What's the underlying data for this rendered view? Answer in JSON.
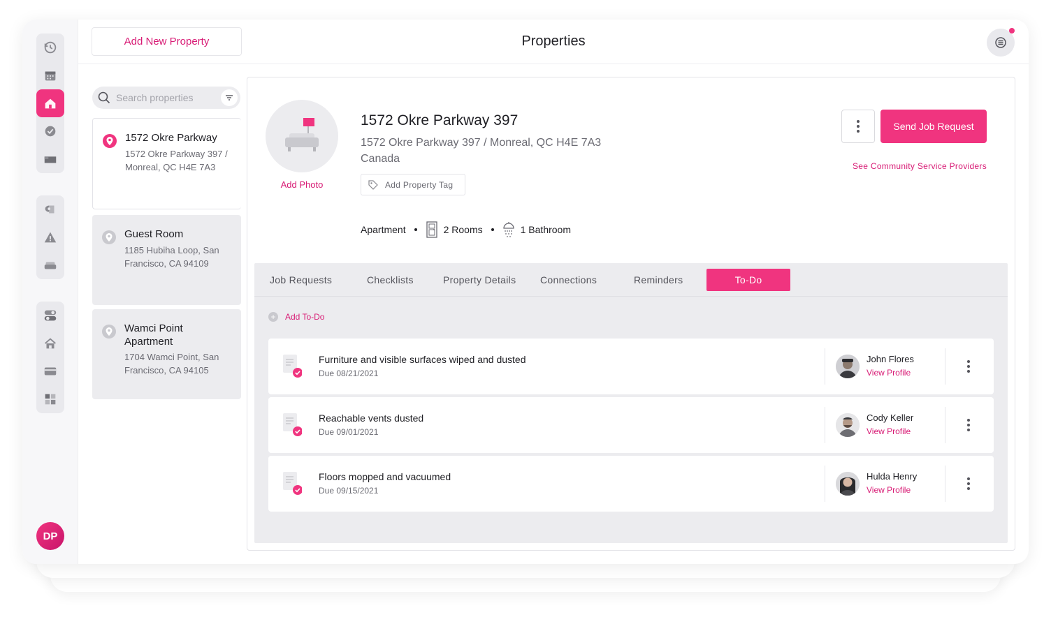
{
  "header": {
    "add_property_label": "Add New Property",
    "title": "Properties"
  },
  "search": {
    "placeholder": "Search properties"
  },
  "properties": [
    {
      "name": "1572 Okre Parkway",
      "address": "1572 Okre Parkway 397 / Monreal, QC H4E 7A3",
      "selected": true
    },
    {
      "name": "Guest Room",
      "address": "1185 Hubiha Loop, San Francisco, CA 94109",
      "selected": false
    },
    {
      "name": "Wamci Point Apartment",
      "address": "1704 Wamci Point, San Francisco, CA 94105",
      "selected": false
    }
  ],
  "detail": {
    "title": "1572 Okre Parkway 397",
    "address_line1": "1572 Okre Parkway 397 / Monreal, QC H4E 7A3",
    "address_line2": "Canada",
    "add_photo_label": "Add Photo",
    "add_tag_label": "Add Property Tag",
    "type": "Apartment",
    "rooms": "2 Rooms",
    "bathrooms": "1 Bathroom",
    "send_job_label": "Send Job Request",
    "community_link": "See Community Service Providers"
  },
  "tabs": [
    {
      "label": "Job Requests",
      "active": false
    },
    {
      "label": "Checklists",
      "active": false
    },
    {
      "label": "Property Details",
      "active": false
    },
    {
      "label": "Connections",
      "active": false
    },
    {
      "label": "Reminders",
      "active": false
    },
    {
      "label": "To-Do",
      "active": true
    }
  ],
  "todo": {
    "add_label": "Add To-Do",
    "view_profile_label": "View Profile",
    "items": [
      {
        "title": "Furniture and visible surfaces wiped and dusted",
        "due": "Due 08/21/2021",
        "assignee": "John Flores",
        "view_profile": "View Profile"
      },
      {
        "title": "Reachable vents dusted",
        "due": "Due 09/01/2021",
        "assignee": "Cody Keller",
        "view_profile": "View Profile"
      },
      {
        "title": "Floors mopped and vacuumed",
        "due": "Due 09/15/2021",
        "assignee": "Hulda Henry",
        "view_profile": "View Profile"
      }
    ]
  },
  "user": {
    "initials": "DP"
  },
  "colors": {
    "accent": "#f0347f",
    "accent_text": "#d81b75",
    "muted_bg": "#ececef"
  },
  "icons": {
    "rail": [
      "history-icon",
      "calendar-icon",
      "home-icon",
      "check-circle-icon",
      "bed-icon",
      "toilet-paper-icon",
      "warning-icon",
      "sofa-icon",
      "toggle-icon",
      "house-outline-icon",
      "credit-card-icon",
      "dashboard-icon"
    ]
  }
}
